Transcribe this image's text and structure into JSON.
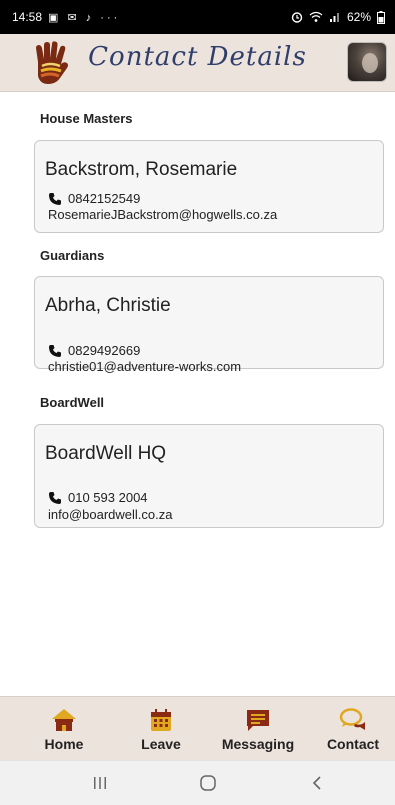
{
  "status_bar": {
    "time": "14:58",
    "notifications": "▣ ✉ ♪ ···",
    "battery": "62%"
  },
  "header": {
    "title": "Contact Details",
    "logo_icon": "hand-logo",
    "avatar_icon": "user-avatar"
  },
  "sections": [
    {
      "title": "House Masters",
      "contact": {
        "name": "Backstrom, Rosemarie",
        "phone": "0842152549",
        "email": "RosemarieJBackstrom@hogwells.co.za"
      }
    },
    {
      "title": "Guardians",
      "contact": {
        "name": "Abrha, Christie",
        "phone": "0829492669",
        "email": "christie01@adventure-works.com"
      }
    },
    {
      "title": "BoardWell",
      "contact": {
        "name": "BoardWell HQ",
        "phone": "010 593 2004",
        "email": "info@boardwell.co.za"
      }
    }
  ],
  "bottom_nav": {
    "items": [
      {
        "label": "Home",
        "icon": "home-icon"
      },
      {
        "label": "Leave",
        "icon": "calendar-icon"
      },
      {
        "label": "Messaging",
        "icon": "message-icon"
      },
      {
        "label": "Contact",
        "icon": "chat-bubbles-icon"
      }
    ]
  },
  "colors": {
    "header_bg": "#ede3dd",
    "title": "#2f3e6b",
    "nav_icon": "#8b2a12",
    "nav_icon_accent": "#e0a820"
  }
}
